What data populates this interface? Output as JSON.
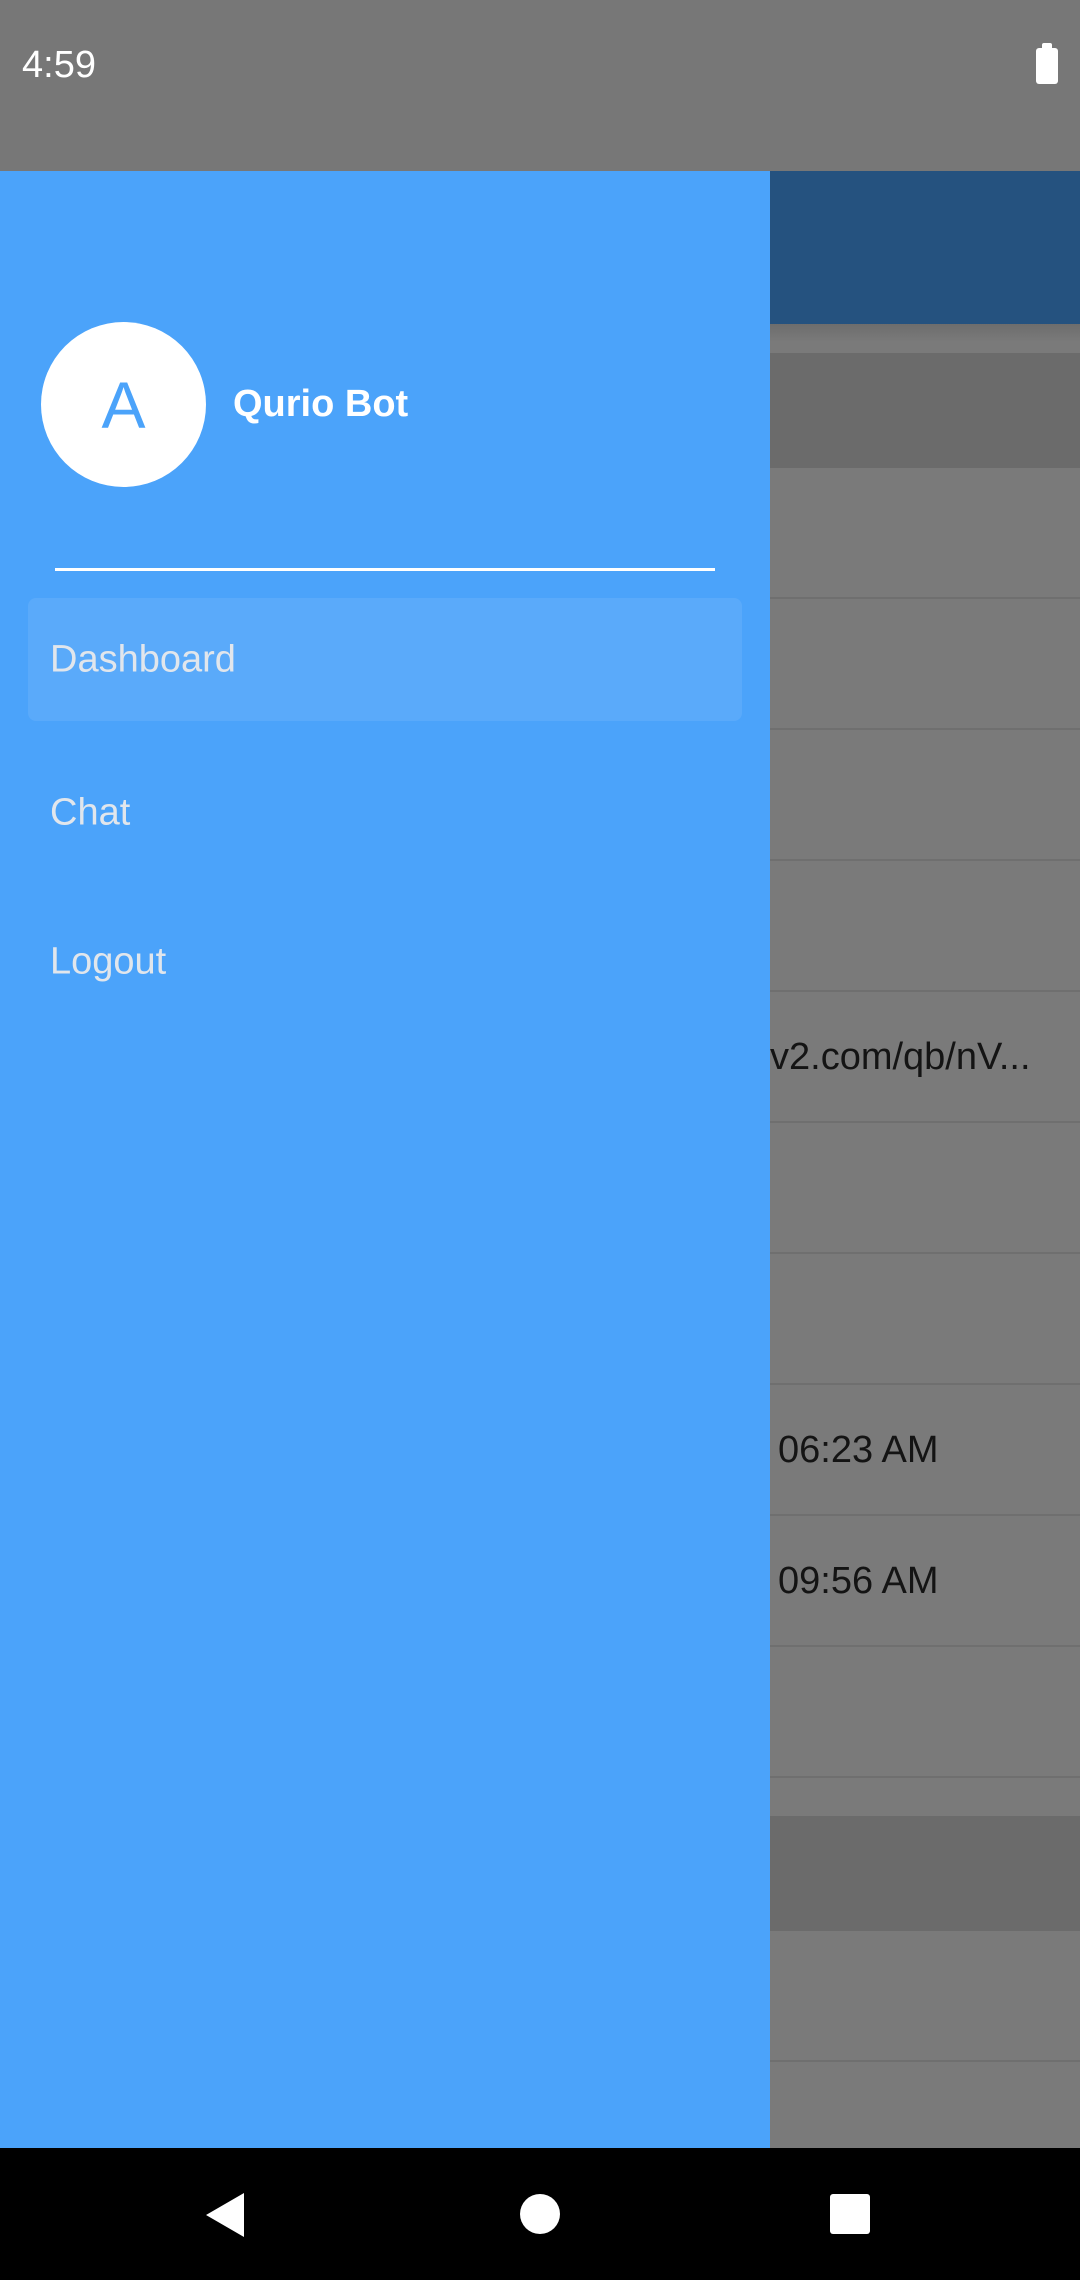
{
  "status_bar": {
    "time": "4:59",
    "battery_icon": "battery-full-icon"
  },
  "background_app": {
    "visible_texts": [
      "v2.com/qb/nV...",
      "06:23 AM",
      "09:56 AM"
    ]
  },
  "drawer": {
    "avatar_letter": "A",
    "user_name": "Qurio Bot",
    "items": [
      {
        "label": "Dashboard",
        "active": true
      },
      {
        "label": "Chat",
        "active": false
      },
      {
        "label": "Logout",
        "active": false
      }
    ]
  },
  "colors": {
    "drawer_background": "#4ba3fa",
    "toolbar_background": "#25527f",
    "scrim": "#7a7a7a"
  },
  "nav_bar": {
    "icons": [
      "back-icon",
      "home-icon",
      "recents-icon"
    ]
  }
}
